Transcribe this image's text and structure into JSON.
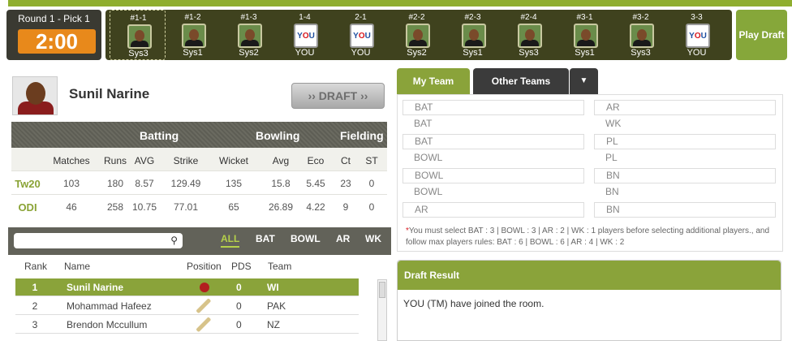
{
  "clock": {
    "round_pick": "Round 1 - Pick 1",
    "time": "2:00"
  },
  "picks": [
    {
      "no": "#1-1",
      "owner": "Sys3",
      "type": "player",
      "current": true
    },
    {
      "no": "#1-2",
      "owner": "Sys1",
      "type": "player"
    },
    {
      "no": "#1-3",
      "owner": "Sys2",
      "type": "player"
    },
    {
      "no": "1-4",
      "owner": "YOU",
      "type": "you"
    },
    {
      "no": "2-1",
      "owner": "YOU",
      "type": "you"
    },
    {
      "no": "#2-2",
      "owner": "Sys2",
      "type": "player"
    },
    {
      "no": "#2-3",
      "owner": "Sys1",
      "type": "player"
    },
    {
      "no": "#2-4",
      "owner": "Sys3",
      "type": "player"
    },
    {
      "no": "#3-1",
      "owner": "Sys1",
      "type": "player"
    },
    {
      "no": "#3-2",
      "owner": "Sys3",
      "type": "player"
    },
    {
      "no": "3-3",
      "owner": "YOU",
      "type": "you"
    }
  ],
  "you_logo": {
    "y": "Y",
    "o": "O",
    "u": "U"
  },
  "play_draft": "Play Draft",
  "player": {
    "name": "Sunil Narine",
    "draft_label": "DRAFT"
  },
  "stats": {
    "groups": [
      "Batting",
      "Bowling",
      "Fielding"
    ],
    "columns": [
      "Matches",
      "Runs",
      "AVG",
      "Strike",
      "Wicket",
      "Avg",
      "Eco",
      "Ct",
      "ST"
    ],
    "rows": [
      {
        "format": "Tw20",
        "values": [
          "103",
          "180",
          "8.57",
          "129.49",
          "135",
          "15.8",
          "5.45",
          "23",
          "0"
        ]
      },
      {
        "format": "ODI",
        "values": [
          "46",
          "258",
          "10.75",
          "77.01",
          "65",
          "26.89",
          "4.22",
          "9",
          "0"
        ]
      }
    ]
  },
  "filters": [
    "ALL",
    "BAT",
    "BOWL",
    "AR",
    "WK"
  ],
  "ranking": {
    "headers": {
      "rank": "Rank",
      "name": "Name",
      "position": "Position",
      "pds": "PDS",
      "team": "Team"
    },
    "rows": [
      {
        "rank": "1",
        "name": "Sunil Narine",
        "pos": "bowl",
        "pds": "0",
        "team": "WI"
      },
      {
        "rank": "2",
        "name": "Mohammad Hafeez",
        "pos": "bat",
        "pds": "0",
        "team": "PAK"
      },
      {
        "rank": "3",
        "name": "Brendon Mccullum",
        "pos": "bat",
        "pds": "0",
        "team": "NZ"
      }
    ]
  },
  "tabs": {
    "my_team": "My Team",
    "other_teams": "Other Teams",
    "caret": "▼"
  },
  "slots_left": [
    "BAT",
    "BAT",
    "BAT",
    "BOWL",
    "BOWL",
    "BOWL",
    "AR"
  ],
  "slots_right": [
    "AR",
    "WK",
    "PL",
    "PL",
    "BN",
    "BN",
    "BN"
  ],
  "rules": {
    "star": "*",
    "text": "You must select BAT : 3 | BOWL : 3 | AR : 2 | WK : 1 players before selecting additional players., and follow max players rules: BAT : 6 | BOWL : 6 | AR : 4 | WK : 2"
  },
  "draft_result": {
    "title": "Draft Result",
    "message": "YOU (TM) have joined the room."
  }
}
